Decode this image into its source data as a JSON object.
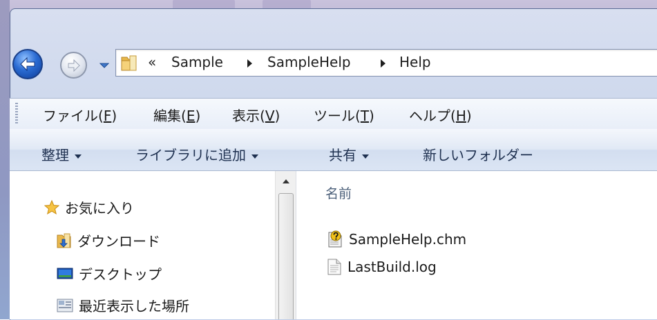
{
  "address_bar": {
    "overflow": "«",
    "segments": [
      "Sample",
      "SampleHelp",
      "Help"
    ]
  },
  "menubar": {
    "items": [
      {
        "label": "ファイル(",
        "key": "F",
        "end": ")"
      },
      {
        "label": "編集(",
        "key": "E",
        "end": ")"
      },
      {
        "label": "表示(",
        "key": "V",
        "end": ")"
      },
      {
        "label": "ツール(",
        "key": "T",
        "end": ")"
      },
      {
        "label": "ヘルプ(",
        "key": "H",
        "end": ")"
      }
    ]
  },
  "command_bar": {
    "organize": "整理",
    "add_to_library": "ライブラリに追加",
    "share": "共有",
    "new_folder": "新しいフォルダー"
  },
  "nav_pane": {
    "items": [
      {
        "label": "お気に入り",
        "icon": "star-icon"
      },
      {
        "label": "ダウンロード",
        "icon": "downloads-folder-icon"
      },
      {
        "label": "デスクトップ",
        "icon": "desktop-icon"
      },
      {
        "label": "最近表示した場所",
        "icon": "recent-places-icon"
      }
    ]
  },
  "file_list": {
    "column_name": "名前",
    "files": [
      {
        "name": "SampleHelp.chm",
        "icon": "chm-help-file-icon"
      },
      {
        "name": "LastBuild.log",
        "icon": "text-file-icon"
      }
    ]
  },
  "colors": {
    "accent_blue": "#2a6bd2",
    "menu_text": "#1b1b1b",
    "command_text": "#1e3050",
    "header_text": "#4c607a"
  }
}
